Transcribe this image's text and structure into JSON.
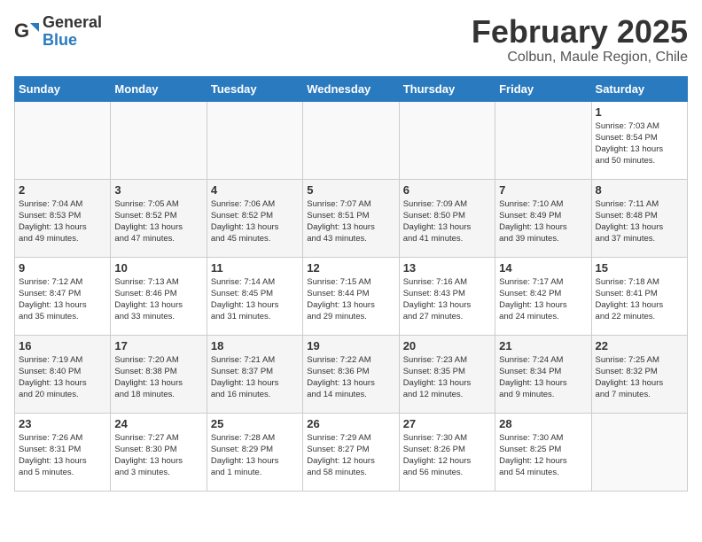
{
  "logo": {
    "general": "General",
    "blue": "Blue"
  },
  "title": "February 2025",
  "subtitle": "Colbun, Maule Region, Chile",
  "weekdays": [
    "Sunday",
    "Monday",
    "Tuesday",
    "Wednesday",
    "Thursday",
    "Friday",
    "Saturday"
  ],
  "weeks": [
    [
      {
        "day": "",
        "info": ""
      },
      {
        "day": "",
        "info": ""
      },
      {
        "day": "",
        "info": ""
      },
      {
        "day": "",
        "info": ""
      },
      {
        "day": "",
        "info": ""
      },
      {
        "day": "",
        "info": ""
      },
      {
        "day": "1",
        "info": "Sunrise: 7:03 AM\nSunset: 8:54 PM\nDaylight: 13 hours\nand 50 minutes."
      }
    ],
    [
      {
        "day": "2",
        "info": "Sunrise: 7:04 AM\nSunset: 8:53 PM\nDaylight: 13 hours\nand 49 minutes."
      },
      {
        "day": "3",
        "info": "Sunrise: 7:05 AM\nSunset: 8:52 PM\nDaylight: 13 hours\nand 47 minutes."
      },
      {
        "day": "4",
        "info": "Sunrise: 7:06 AM\nSunset: 8:52 PM\nDaylight: 13 hours\nand 45 minutes."
      },
      {
        "day": "5",
        "info": "Sunrise: 7:07 AM\nSunset: 8:51 PM\nDaylight: 13 hours\nand 43 minutes."
      },
      {
        "day": "6",
        "info": "Sunrise: 7:09 AM\nSunset: 8:50 PM\nDaylight: 13 hours\nand 41 minutes."
      },
      {
        "day": "7",
        "info": "Sunrise: 7:10 AM\nSunset: 8:49 PM\nDaylight: 13 hours\nand 39 minutes."
      },
      {
        "day": "8",
        "info": "Sunrise: 7:11 AM\nSunset: 8:48 PM\nDaylight: 13 hours\nand 37 minutes."
      }
    ],
    [
      {
        "day": "9",
        "info": "Sunrise: 7:12 AM\nSunset: 8:47 PM\nDaylight: 13 hours\nand 35 minutes."
      },
      {
        "day": "10",
        "info": "Sunrise: 7:13 AM\nSunset: 8:46 PM\nDaylight: 13 hours\nand 33 minutes."
      },
      {
        "day": "11",
        "info": "Sunrise: 7:14 AM\nSunset: 8:45 PM\nDaylight: 13 hours\nand 31 minutes."
      },
      {
        "day": "12",
        "info": "Sunrise: 7:15 AM\nSunset: 8:44 PM\nDaylight: 13 hours\nand 29 minutes."
      },
      {
        "day": "13",
        "info": "Sunrise: 7:16 AM\nSunset: 8:43 PM\nDaylight: 13 hours\nand 27 minutes."
      },
      {
        "day": "14",
        "info": "Sunrise: 7:17 AM\nSunset: 8:42 PM\nDaylight: 13 hours\nand 24 minutes."
      },
      {
        "day": "15",
        "info": "Sunrise: 7:18 AM\nSunset: 8:41 PM\nDaylight: 13 hours\nand 22 minutes."
      }
    ],
    [
      {
        "day": "16",
        "info": "Sunrise: 7:19 AM\nSunset: 8:40 PM\nDaylight: 13 hours\nand 20 minutes."
      },
      {
        "day": "17",
        "info": "Sunrise: 7:20 AM\nSunset: 8:38 PM\nDaylight: 13 hours\nand 18 minutes."
      },
      {
        "day": "18",
        "info": "Sunrise: 7:21 AM\nSunset: 8:37 PM\nDaylight: 13 hours\nand 16 minutes."
      },
      {
        "day": "19",
        "info": "Sunrise: 7:22 AM\nSunset: 8:36 PM\nDaylight: 13 hours\nand 14 minutes."
      },
      {
        "day": "20",
        "info": "Sunrise: 7:23 AM\nSunset: 8:35 PM\nDaylight: 13 hours\nand 12 minutes."
      },
      {
        "day": "21",
        "info": "Sunrise: 7:24 AM\nSunset: 8:34 PM\nDaylight: 13 hours\nand 9 minutes."
      },
      {
        "day": "22",
        "info": "Sunrise: 7:25 AM\nSunset: 8:32 PM\nDaylight: 13 hours\nand 7 minutes."
      }
    ],
    [
      {
        "day": "23",
        "info": "Sunrise: 7:26 AM\nSunset: 8:31 PM\nDaylight: 13 hours\nand 5 minutes."
      },
      {
        "day": "24",
        "info": "Sunrise: 7:27 AM\nSunset: 8:30 PM\nDaylight: 13 hours\nand 3 minutes."
      },
      {
        "day": "25",
        "info": "Sunrise: 7:28 AM\nSunset: 8:29 PM\nDaylight: 13 hours\nand 1 minute."
      },
      {
        "day": "26",
        "info": "Sunrise: 7:29 AM\nSunset: 8:27 PM\nDaylight: 12 hours\nand 58 minutes."
      },
      {
        "day": "27",
        "info": "Sunrise: 7:30 AM\nSunset: 8:26 PM\nDaylight: 12 hours\nand 56 minutes."
      },
      {
        "day": "28",
        "info": "Sunrise: 7:30 AM\nSunset: 8:25 PM\nDaylight: 12 hours\nand 54 minutes."
      },
      {
        "day": "",
        "info": ""
      }
    ]
  ]
}
